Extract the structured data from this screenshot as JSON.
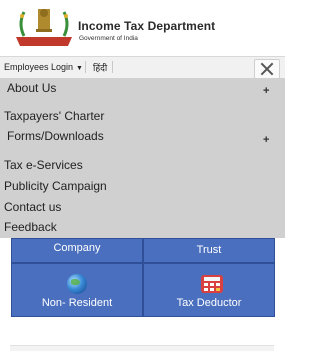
{
  "header": {
    "title": "Income Tax Department",
    "subtitle": "Government of India",
    "emblem_ribbon": "INCOME TAX DEPARTMENT"
  },
  "topbar": {
    "employees_login": "Employees Login",
    "language": "हिंदी",
    "close_icon": "close-icon"
  },
  "menu": {
    "items": [
      {
        "label": "About Us",
        "expandable": true
      },
      {
        "label": "Taxpayers' Charter",
        "expandable": false
      },
      {
        "label": "Forms/Downloads",
        "expandable": true
      },
      {
        "label": "Tax e-Services",
        "expandable": false
      },
      {
        "label": "Publicity Campaign",
        "expandable": false
      },
      {
        "label": "Contact us",
        "expandable": false
      },
      {
        "label": "Feedback",
        "expandable": false
      }
    ],
    "expand_symbol": "+"
  },
  "tiles": [
    {
      "label": "Company"
    },
    {
      "label": "Trust"
    },
    {
      "label": "Non- Resident",
      "icon": "globe-icon"
    },
    {
      "label": "Tax Deductor",
      "icon": "calculator-icon"
    }
  ],
  "colors": {
    "menu_bg": "#d0d0d0",
    "tile_bg": "#4a6fbf",
    "ribbon": "#c0392b",
    "emblem_wreath": "#3a8f3a"
  }
}
